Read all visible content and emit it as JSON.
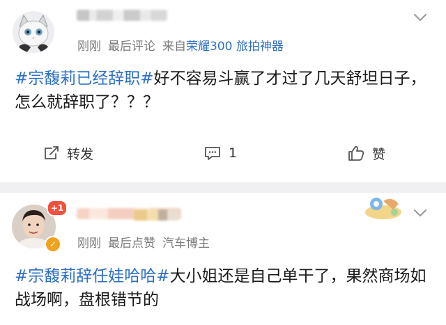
{
  "post1": {
    "meta": {
      "time": "刚刚",
      "action": "最后评论",
      "source_prefix": "来自",
      "device": "荣耀300 旅拍神器"
    },
    "content": {
      "hashtag": "#宗馥莉已经辞职#",
      "text": "好不容易斗赢了才过了几天舒坦日子，怎么就辞职了？？？"
    },
    "actions": {
      "share_label": "转发",
      "comment_count": "1",
      "like_label": "赞"
    }
  },
  "post2": {
    "badge": "+1",
    "meta": {
      "time": "刚刚",
      "action": "最后点赞",
      "role": "汽车博主"
    },
    "content": {
      "hashtag": "#宗馥莉辞任娃哈哈#",
      "text": "大小姐还是自己单干了，果然商场如战场啊，盘根错节的"
    }
  },
  "colors": {
    "hashtag": "#2c6fc4",
    "device": "#2e6fc2",
    "meta": "#7a7a7a",
    "divider": "#f0f0f2",
    "badge": "#f0503c"
  },
  "icons": [
    "cat-avatar",
    "chevron-down-icon",
    "share-icon",
    "comment-icon",
    "like-icon",
    "verified-badge-icon",
    "sticker-image"
  ]
}
